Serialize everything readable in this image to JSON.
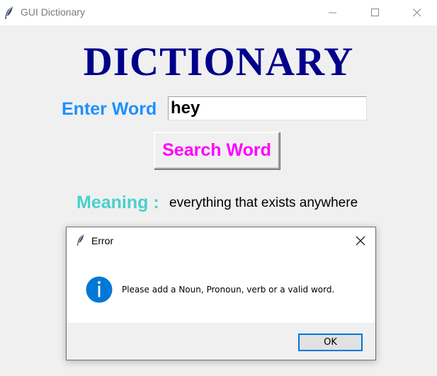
{
  "window": {
    "title": "GUI Dictionary",
    "app_icon": "feather-icon",
    "controls": [
      "minimize-icon",
      "maximize-icon",
      "close-icon"
    ]
  },
  "app": {
    "heading": "DICTIONARY",
    "enter_label": "Enter Word",
    "word_value": "hey",
    "search_label": "Search Word",
    "meaning_label": "Meaning :",
    "meaning_text": "everything that exists anywhere"
  },
  "dialog": {
    "title": "Error",
    "icon": "info-icon",
    "message": "Please add a Noun, Pronoun, verb or a valid word.",
    "ok_label": "OK"
  },
  "colors": {
    "heading": "#00008b",
    "enter_label": "#1e90ff",
    "search_label": "#ff00ff",
    "meaning_label": "#48d1cc",
    "info_icon": "#0078d7",
    "ok_border": "#0078d7"
  }
}
